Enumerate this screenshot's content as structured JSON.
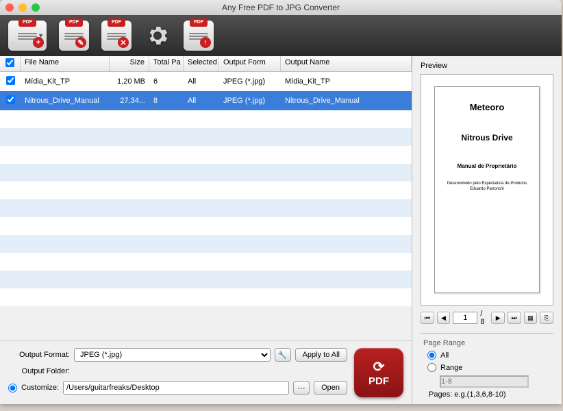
{
  "title": "Any Free PDF to JPG Converter",
  "toolbar": {
    "pdf_label": "PDF"
  },
  "table": {
    "headers": {
      "filename": "File Name",
      "size": "Size",
      "total": "Total Pa",
      "selected": "Selected",
      "format": "Output Form",
      "outname": "Output Name"
    },
    "rows": [
      {
        "checked": true,
        "selected": false,
        "filename": "Mídia_Kit_TP",
        "size": "1,20 MB",
        "total": "6",
        "sel": "All",
        "format": "JPEG (*.jpg)",
        "outname": "Mídia_Kit_TP"
      },
      {
        "checked": true,
        "selected": true,
        "filename": "Nitrous_Drive_Manual",
        "size": "27,34...",
        "total": "8",
        "sel": "All",
        "format": "JPEG (*.jpg)",
        "outname": "Nitrous_Drive_Manual"
      }
    ]
  },
  "footer": {
    "output_format_label": "Output Format:",
    "output_format_value": "JPEG (*.jpg)",
    "apply_all": "Apply to All",
    "output_folder_label": "Output Folder:",
    "customize_label": "Customize:",
    "customize_path": "/Users/guitarfreaks/Desktop",
    "open": "Open",
    "big_label": "PDF"
  },
  "preview": {
    "label": "Preview",
    "page": {
      "t1": "Meteoro",
      "t2": "Nitrous Drive",
      "t3": "Manual de Proprietário",
      "t4a": "Desenvolvido pelo Especialista de Produtos",
      "t4b": "Eduardo Patronchi"
    },
    "current": "1",
    "total_sep": "/ 8"
  },
  "range": {
    "legend": "Page Range",
    "all": "All",
    "range": "Range",
    "placeholder": "1-8",
    "note": "Pages: e.g.(1,3,6,8-10)"
  }
}
